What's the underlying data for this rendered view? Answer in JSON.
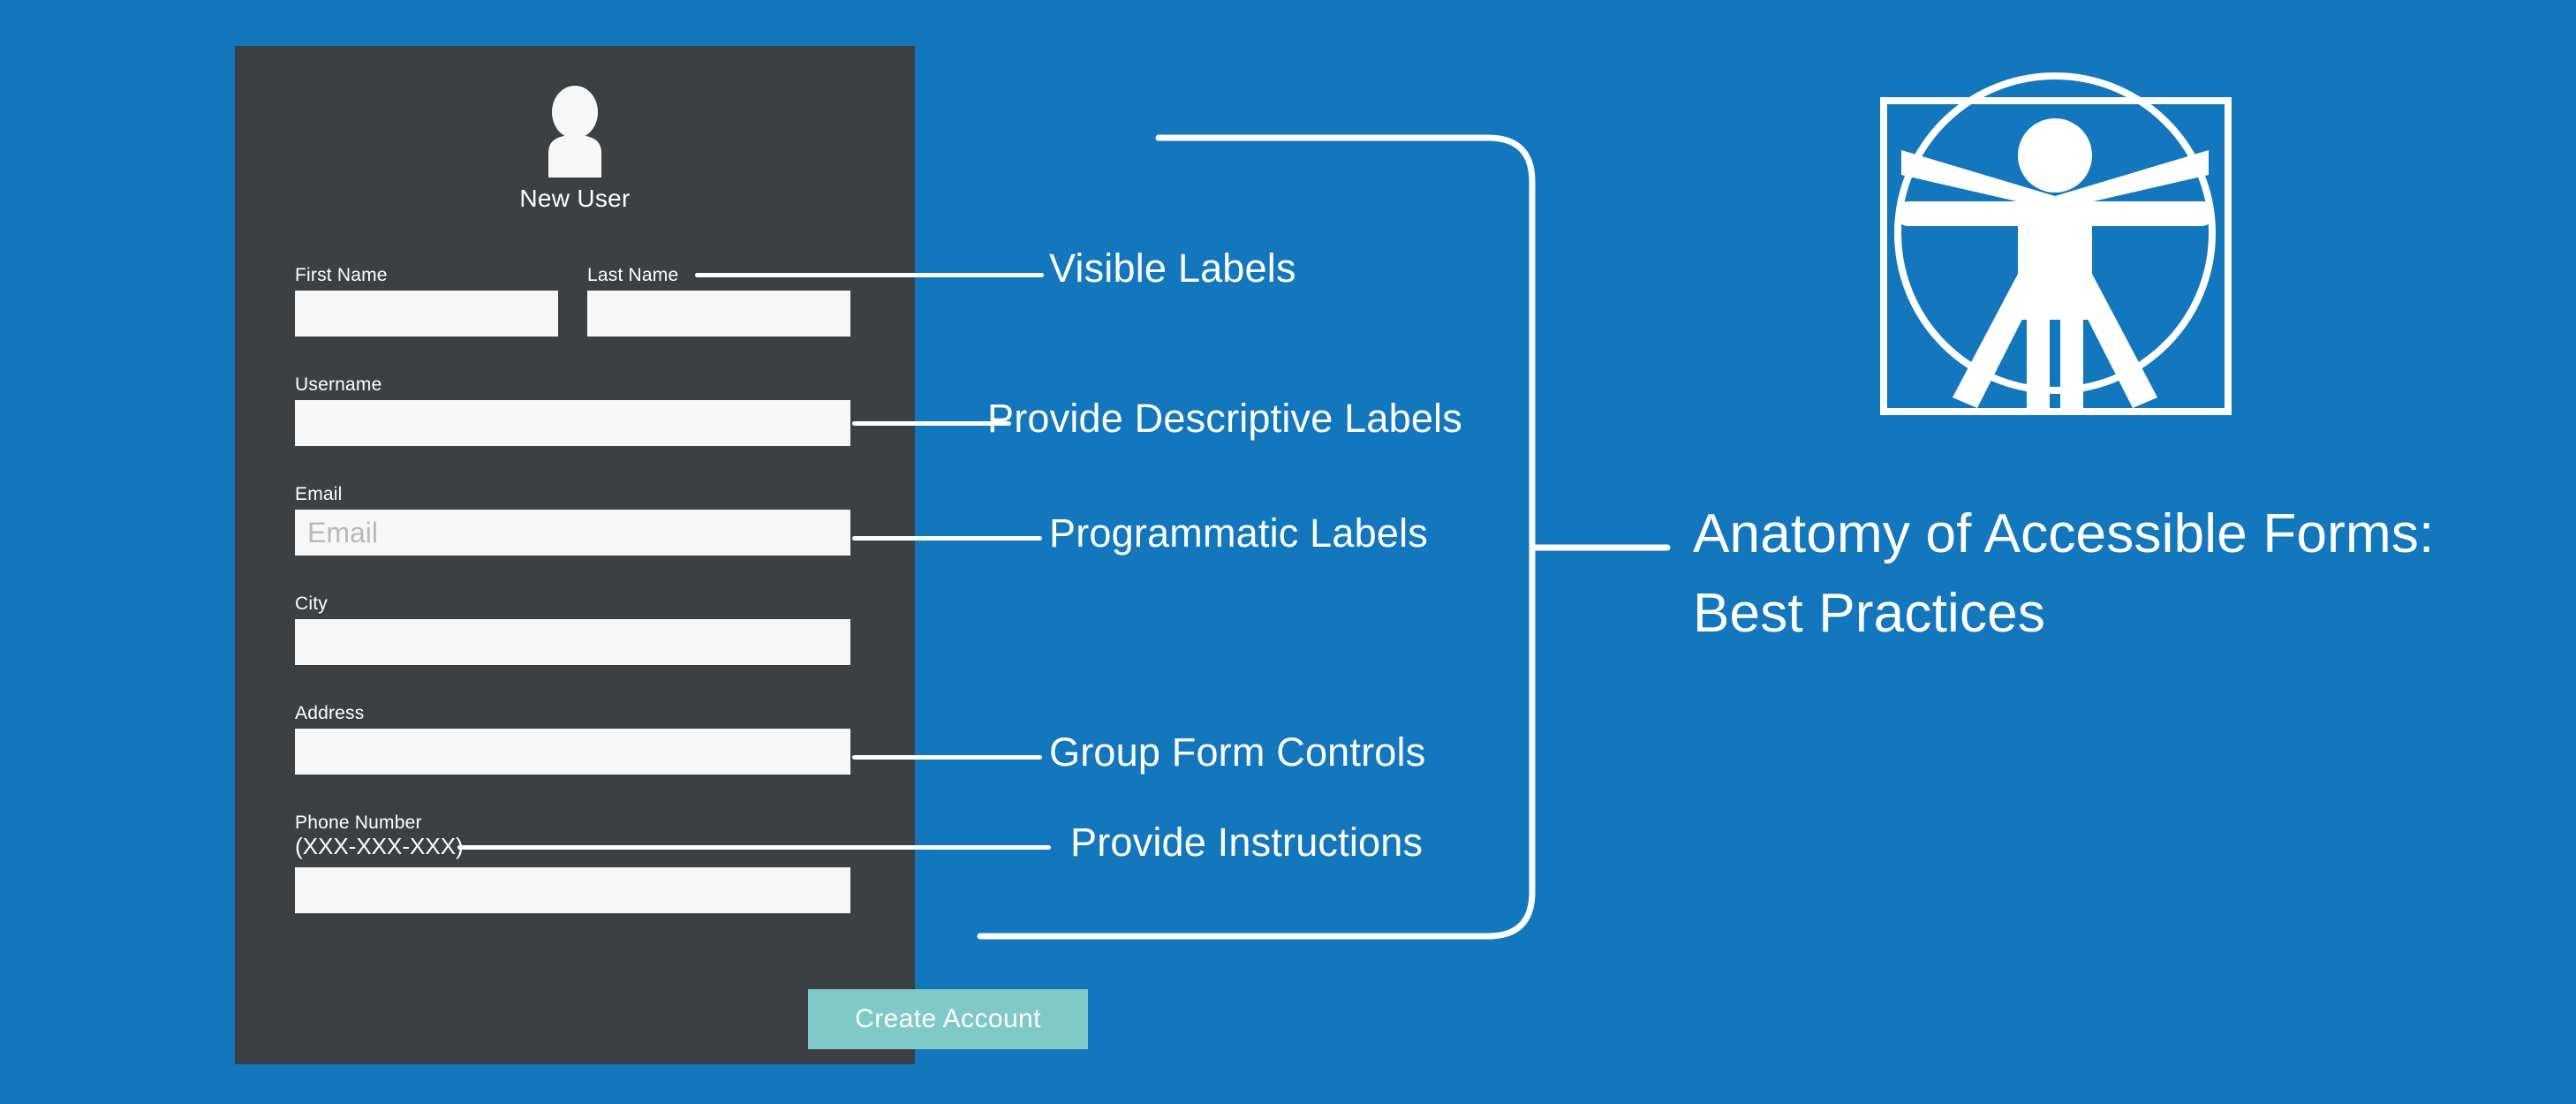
{
  "colors": {
    "background_blue": "#1277bc",
    "panel_dark": "#3c4042",
    "input_white": "#f7f7f7",
    "button_teal": "#7fc9c9",
    "line_white": "#ffffff",
    "placeholder_grey": "#b9b9b9"
  },
  "form": {
    "avatar_icon": "user-avatar-icon",
    "avatar_caption": "New User",
    "fields": [
      {
        "label": "First Name",
        "placeholder": "",
        "value": ""
      },
      {
        "label": "Last Name",
        "placeholder": "",
        "value": ""
      },
      {
        "label": "Username",
        "placeholder": "",
        "value": ""
      },
      {
        "label": "Email",
        "placeholder": "Email",
        "value": ""
      },
      {
        "label": "City",
        "placeholder": "",
        "value": ""
      },
      {
        "label": "Address",
        "placeholder": "",
        "value": ""
      },
      {
        "label": "Phone Number",
        "hint": "(XXX-XXX-XXX)",
        "placeholder": "",
        "value": ""
      }
    ],
    "submit_label": "Create Account"
  },
  "annotations": [
    {
      "text": "Visible Labels",
      "target": "Last Name label"
    },
    {
      "text": "Provide Descriptive Labels",
      "target": "Username field"
    },
    {
      "text": "Programmatic Labels",
      "target": "Email field"
    },
    {
      "text": "Group Form Controls",
      "target": "Address field"
    },
    {
      "text": "Provide Instructions",
      "target": "Phone Number hint"
    }
  ],
  "right": {
    "icon": "vitruvian-man-accessibility-icon",
    "title_line_1": "Anatomy of Accessible Forms:",
    "title_line_2": "Best Practices"
  }
}
